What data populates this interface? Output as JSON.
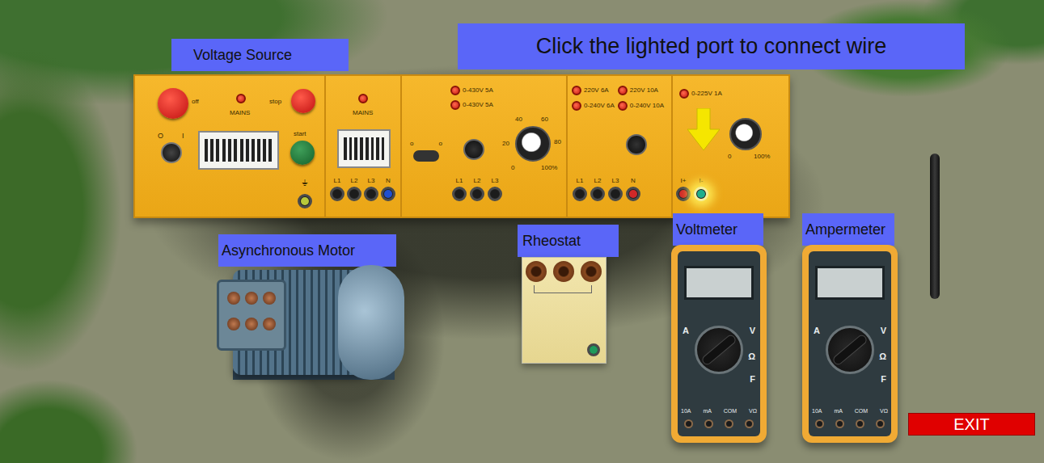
{
  "instruction": "Click the lighted port to connect wire",
  "exit_button": "EXIT",
  "voltage_source": {
    "label": "Voltage Source",
    "main_section": {
      "off_button": "off",
      "mains_lamp": "MAINS",
      "stop_button": "stop",
      "start_button": "start",
      "key_marks": [
        "O",
        "I"
      ],
      "ground_symbol": "⏚",
      "ground_port": {
        "color": "#b9c83a",
        "lit": false
      }
    },
    "mains_section": {
      "mains_lamp": "MAINS",
      "terminals": [
        {
          "label": "L1",
          "color": "#1c1c1c",
          "lit": false
        },
        {
          "label": "L2",
          "color": "#1c1c1c",
          "lit": false
        },
        {
          "label": "L3",
          "color": "#1c1c1c",
          "lit": false
        },
        {
          "label": "N",
          "color": "#2050d0",
          "lit": false
        }
      ]
    },
    "three_phase_section": {
      "lamps": [
        "0-430V 5A",
        "0-430V 5A"
      ],
      "switch_marks": [
        "o",
        "o"
      ],
      "knob_scale": [
        "20",
        "40",
        "60",
        "80"
      ],
      "knob_min": "0",
      "knob_max": "100%",
      "terminals": [
        {
          "label": "L1",
          "color": "#1c1c1c",
          "lit": false
        },
        {
          "label": "L2",
          "color": "#1c1c1c",
          "lit": false
        },
        {
          "label": "L3",
          "color": "#1c1c1c",
          "lit": false
        }
      ]
    },
    "single_phase_section": {
      "lamps": [
        "220V 6A",
        "220V 10A",
        "0-240V 6A",
        "0-240V 10A"
      ],
      "terminals": [
        {
          "label": "L1",
          "color": "#1c1c1c",
          "lit": false
        },
        {
          "label": "L2",
          "color": "#1c1c1c",
          "lit": false
        },
        {
          "label": "L3",
          "color": "#1c1c1c",
          "lit": false
        },
        {
          "label": "N",
          "color": "#d02828",
          "lit": false
        }
      ]
    },
    "dc_section": {
      "lamp": "0-225V 1A",
      "knob_min": "0",
      "knob_max": "100%",
      "terminals": [
        {
          "label": "I+",
          "color": "#d02828",
          "lit": false
        },
        {
          "label": "I-",
          "color": "#1fae8c",
          "lit": true
        }
      ]
    }
  },
  "motor": {
    "label": "Asynchronous Motor"
  },
  "rheostat": {
    "label": "Rheostat",
    "port": {
      "color": "#1f9a5c",
      "lit": false
    }
  },
  "meters": [
    {
      "label": "Voltmeter",
      "dial_marks": {
        "a": "A",
        "v": "V",
        "ohm": "Ω",
        "f": "F"
      },
      "jacks": [
        "10A",
        "mA",
        "COM",
        "VΩ"
      ]
    },
    {
      "label": "Ampermeter",
      "dial_marks": {
        "a": "A",
        "v": "V",
        "ohm": "Ω",
        "f": "F"
      },
      "jacks": [
        "10A",
        "mA",
        "COM",
        "VΩ"
      ]
    }
  ]
}
